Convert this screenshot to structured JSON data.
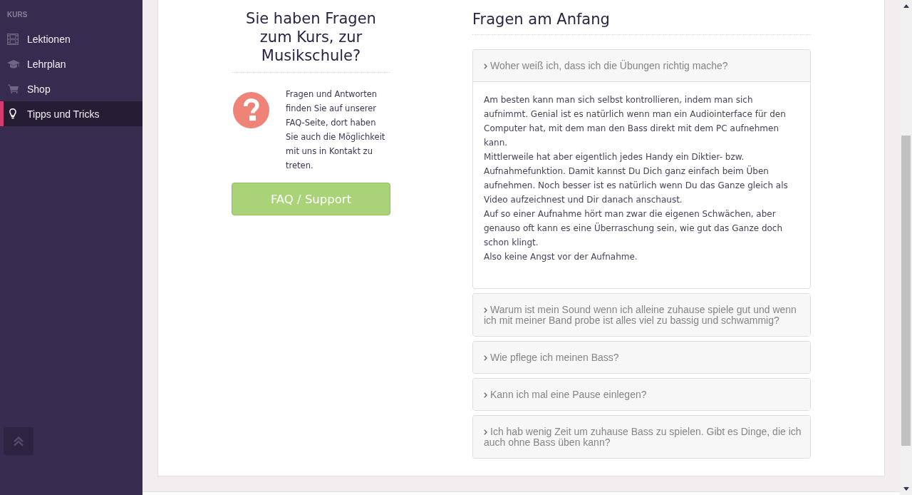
{
  "sidebar": {
    "section_label": "KURS",
    "items": [
      {
        "label": "Lektionen",
        "selected": false
      },
      {
        "label": "Lehrplan",
        "selected": false
      },
      {
        "label": "Shop",
        "selected": false
      },
      {
        "label": "Tipps und Tricks",
        "selected": true
      }
    ]
  },
  "help_box": {
    "title": "Sie haben Fragen zum Kurs, zur Musikschule?",
    "text": "Fragen und Antworten finden Sie auf unserer FAQ-Seite, dort haben Sie auch die Möglichkeit mit uns in Kontakt zu treten.",
    "button": "FAQ / Support"
  },
  "faq": {
    "title": "Fragen am Anfang",
    "items": [
      {
        "question": "Woher weiß ich, dass ich die Übungen richtig mache?",
        "expanded": true,
        "answer": [
          "Am besten kann man sich selbst kontrollieren, indem man sich aufnimmt. Genial ist es natürlich wenn man ein Audiointerface für den Computer hat, mit dem man den Bass direkt mit dem PC aufnehmen kann.",
          "Mittlerweile hat aber eigentlich jedes Handy ein Diktier- bzw. Aufnahmefunktion. Damit kannst Du Dich ganz einfach beim Üben aufnehmen. Noch besser ist es natürlich wenn Du das Ganze gleich als Video aufzeichnest und Dir danach anschaust.",
          "Auf so einer Aufnahme hört man zwar die eigenen Schwächen, aber genauso oft kann es eine Überraschung sein, wie gut das Ganze doch schon klingt.",
          "Also keine Angst vor der Aufnahme."
        ]
      },
      {
        "question": "Warum ist mein Sound wenn ich alleine zuhause spiele gut und wenn ich mit meiner Band probe ist alles viel zu bassig und schwammig?",
        "expanded": false
      },
      {
        "question": "Wie pflege ich meinen Bass?",
        "expanded": false
      },
      {
        "question": "Kann ich mal eine Pause einlegen?",
        "expanded": false
      },
      {
        "question": "Ich hab wenig Zeit um zuhause Bass zu spielen. Gibt es Dinge, die ich auch ohne Bass üben kann?",
        "expanded": false
      }
    ]
  }
}
